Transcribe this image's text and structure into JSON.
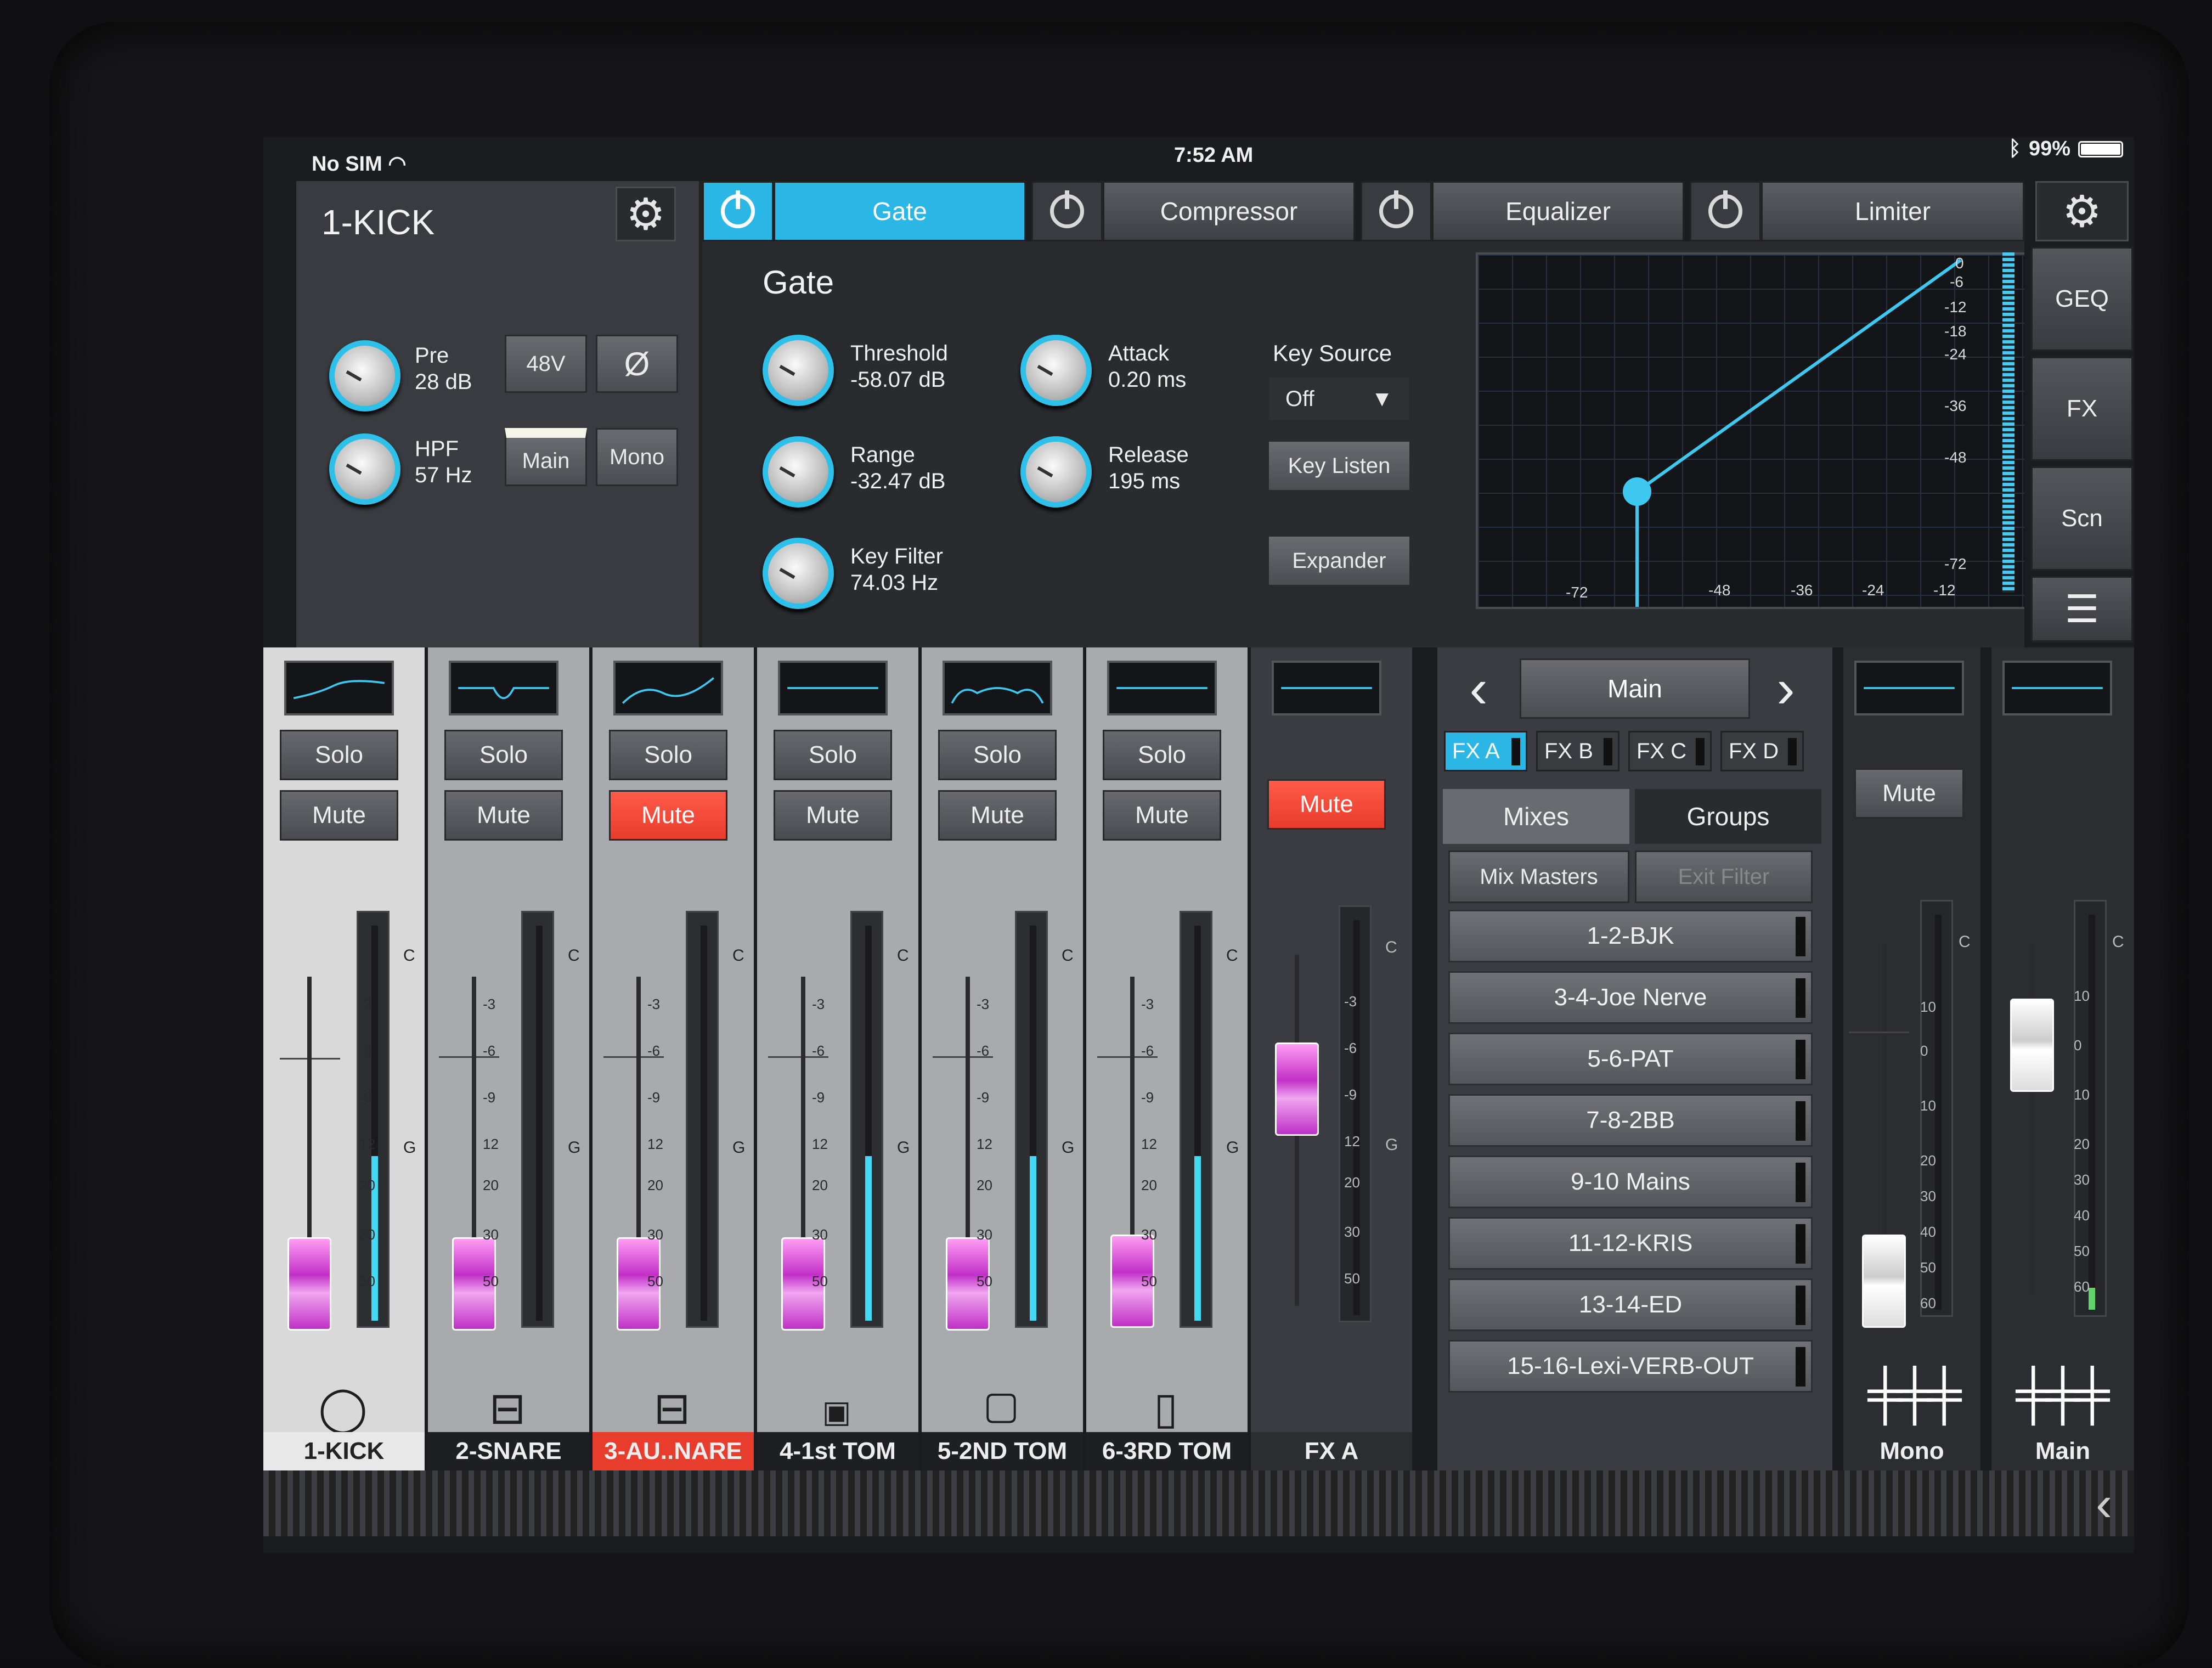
{
  "status": {
    "carrier": "No SIM",
    "time": "7:52 AM",
    "battery": "99%"
  },
  "channel": {
    "name": "1-KICK",
    "pre_label": "Pre",
    "pre_value": "28 dB",
    "hpf_label": "HPF",
    "hpf_value": "57 Hz",
    "btn_48v": "48V",
    "btn_phase": "Ø",
    "btn_main": "Main",
    "btn_mono": "Mono"
  },
  "tabs": [
    "Gate",
    "Compressor",
    "Equalizer",
    "Limiter"
  ],
  "gate": {
    "title": "Gate",
    "threshold_label": "Threshold",
    "threshold_value": "-58.07 dB",
    "range_label": "Range",
    "range_value": "-32.47 dB",
    "keyfilter_label": "Key Filter",
    "keyfilter_value": "74.03 Hz",
    "attack_label": "Attack",
    "attack_value": "0.20 ms",
    "release_label": "Release",
    "release_value": "195 ms",
    "keysource_label": "Key Source",
    "keysource_value": "Off",
    "keylisten": "Key Listen",
    "expander": "Expander",
    "graph_y_ticks": [
      "0",
      "-6",
      "-12",
      "-18",
      "-24",
      "-36",
      "-48",
      "-72"
    ],
    "graph_x_ticks": [
      "-72",
      "-48",
      "-36",
      "-24",
      "-12"
    ]
  },
  "side": [
    "GEQ",
    "FX",
    "Scn"
  ],
  "strips": [
    {
      "name": "1-KICK",
      "solo": "Solo",
      "mute": "Mute",
      "muted": false,
      "icon": "kick-drum-icon"
    },
    {
      "name": "2-SNARE",
      "solo": "Solo",
      "mute": "Mute",
      "muted": false,
      "icon": "snare-drum-icon"
    },
    {
      "name": "3-AU..NARE",
      "solo": "Solo",
      "mute": "Mute",
      "muted": true,
      "icon": "snare-drum-icon"
    },
    {
      "name": "4-1st TOM",
      "solo": "Solo",
      "mute": "Mute",
      "muted": false,
      "icon": "tom-drum-icon"
    },
    {
      "name": "5-2ND TOM",
      "solo": "Solo",
      "mute": "Mute",
      "muted": false,
      "icon": "tom-drum-icon"
    },
    {
      "name": "6-3RD TOM",
      "solo": "Solo",
      "mute": "Mute",
      "muted": false,
      "icon": "floor-tom-icon"
    },
    {
      "name": "FX A",
      "mute": "Mute",
      "muted": true
    }
  ],
  "meter_scale": [
    "-3",
    "-6",
    "-9",
    "12",
    "20",
    "30",
    "50"
  ],
  "meter_marks": {
    "clip": "C",
    "gate": "G"
  },
  "mixpanel": {
    "selected_mix": "Main",
    "fx_buttons": [
      "FX A",
      "FX B",
      "FX C",
      "FX D"
    ],
    "tab_mixes": "Mixes",
    "tab_groups": "Groups",
    "mix_masters": "Mix Masters",
    "exit_filter": "Exit Filter",
    "mixes": [
      "1-2-BJK",
      "3-4-Joe Nerve",
      "5-6-PAT",
      "7-8-2BB",
      "9-10 Mains",
      "11-12-KRIS",
      "13-14-ED",
      "15-16-Lexi-VERB-OUT"
    ]
  },
  "buses": [
    {
      "name": "Mono",
      "mute": "Mute"
    },
    {
      "name": "Main"
    }
  ],
  "bus_scale": [
    "10",
    "0",
    "10",
    "20",
    "30",
    "40",
    "50",
    "60"
  ]
}
